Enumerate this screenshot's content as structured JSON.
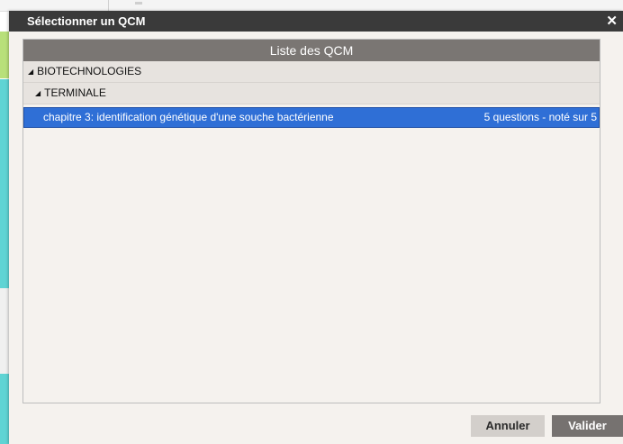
{
  "dialog": {
    "title": "Sélectionner un QCM",
    "close_glyph": "✕"
  },
  "list": {
    "header": "Liste des QCM",
    "groups": [
      {
        "label": "BIOTECHNOLOGIES",
        "expanded": true
      },
      {
        "label": "TERMINALE",
        "expanded": true
      }
    ],
    "items": [
      {
        "title": "chapitre 3: identification génétique d'une souche bactérienne",
        "meta": "5 questions - noté sur 5",
        "selected": true
      }
    ]
  },
  "buttons": {
    "cancel_label": "Annuler",
    "ok_label": "Valider"
  },
  "colors": {
    "titlebar": "#3a3a3a",
    "list_header": "#7a7673",
    "selection": "#2f6fd6",
    "dialog_bg": "#f5f2ee"
  },
  "icons": {
    "expand": "triangle-expanded-icon",
    "close": "close-icon"
  }
}
